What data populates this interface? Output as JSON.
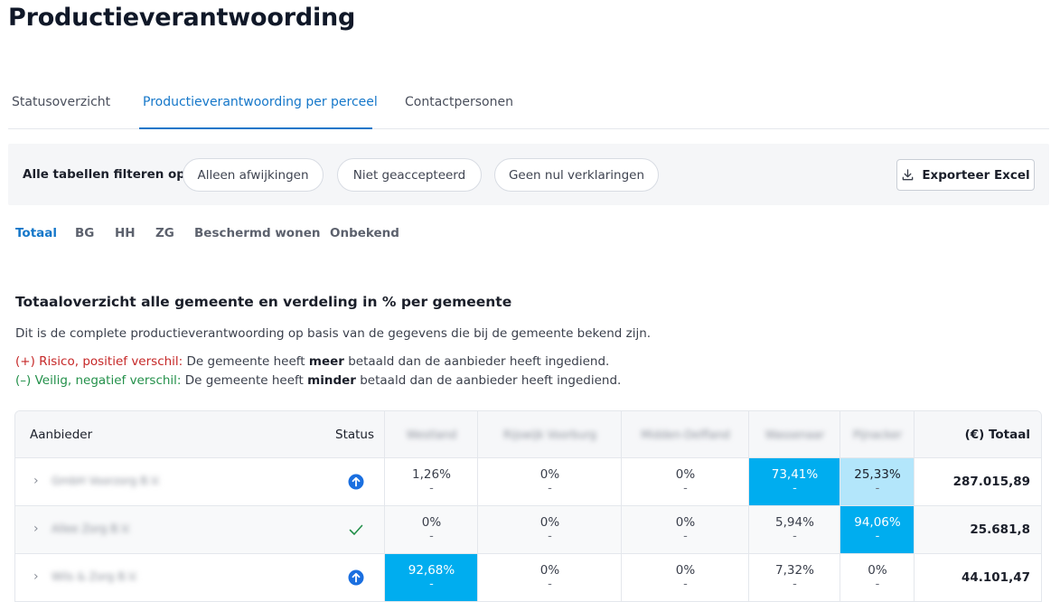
{
  "page": {
    "title": "Productieverantwoording"
  },
  "tabs": [
    {
      "label": "Statusoverzicht",
      "active": false
    },
    {
      "label": "Productieverantwoording per perceel",
      "active": true
    },
    {
      "label": "Contactpersonen",
      "active": false
    }
  ],
  "filters": {
    "label": "Alle tabellen filteren op:",
    "pills": [
      "Alleen afwijkingen",
      "Niet geaccepteerd",
      "Geen nul verklaringen"
    ],
    "export_label": "Exporteer Excel",
    "export_icon": "download-icon"
  },
  "subtabs": [
    "Totaal",
    "BG",
    "HH",
    "ZG",
    "Beschermd wonen",
    "Onbekend"
  ],
  "section": {
    "title": "Totaaloverzicht alle gemeente en verdeling in % per gemeente",
    "description": "Dit is de complete productieverantwoording op basis van de gegevens die bij de gemeente bekend zijn.",
    "risk_label": "(+) Risico, positief verschil:",
    "risk_text_pre": "De gemeente heeft",
    "risk_bold": "meer",
    "risk_text_post": "betaald dan de aanbieder heeft ingediend.",
    "safe_label": "(–) Veilig, negatief verschil:",
    "safe_text_pre": "De gemeente heeft",
    "safe_bold": "minder",
    "safe_text_post": "betaald dan de aanbieder heeft ingediend."
  },
  "table": {
    "headers": {
      "provider": "Aanbieder",
      "status": "Status",
      "gemeenten": [
        "Westland",
        "Rijswijk Voorburg",
        "Midden-Delfland",
        "Wassenaar",
        "Pijnacker"
      ],
      "total": "(€) Totaal"
    },
    "rows": [
      {
        "name": "GmbH Voorzorg B.V.",
        "status_icon": "arrow-up-circle-icon",
        "cells": [
          {
            "pct": "1,26%",
            "dash": "-"
          },
          {
            "pct": "0%",
            "dash": "-"
          },
          {
            "pct": "0%",
            "dash": "-"
          },
          {
            "pct": "73,41%",
            "dash": "-"
          },
          {
            "pct": "25,33%",
            "dash": "-"
          }
        ],
        "total": "287.015,89"
      },
      {
        "name": "Allee Zorg B.V.",
        "status_icon": "checkmark-icon",
        "cells": [
          {
            "pct": "0%",
            "dash": "-"
          },
          {
            "pct": "0%",
            "dash": "-"
          },
          {
            "pct": "0%",
            "dash": "-"
          },
          {
            "pct": "5,94%",
            "dash": "-"
          },
          {
            "pct": "94,06%",
            "dash": "-"
          }
        ],
        "total": "25.681,8"
      },
      {
        "name": "Wils & Zorg B.V.",
        "status_icon": "arrow-up-circle-icon",
        "cells": [
          {
            "pct": "92,68%",
            "dash": "-"
          },
          {
            "pct": "0%",
            "dash": "-"
          },
          {
            "pct": "0%",
            "dash": "-"
          },
          {
            "pct": "7,32%",
            "dash": "-"
          },
          {
            "pct": "0%",
            "dash": "-"
          }
        ],
        "total": "44.101,47"
      }
    ]
  },
  "colors": {
    "accent": "#1577c9",
    "highlight_strong": "#00adef",
    "highlight_light": "#b3e6fb",
    "risk": "#c62828",
    "safe": "#23904a",
    "status_blue": "#1a6fe0"
  }
}
